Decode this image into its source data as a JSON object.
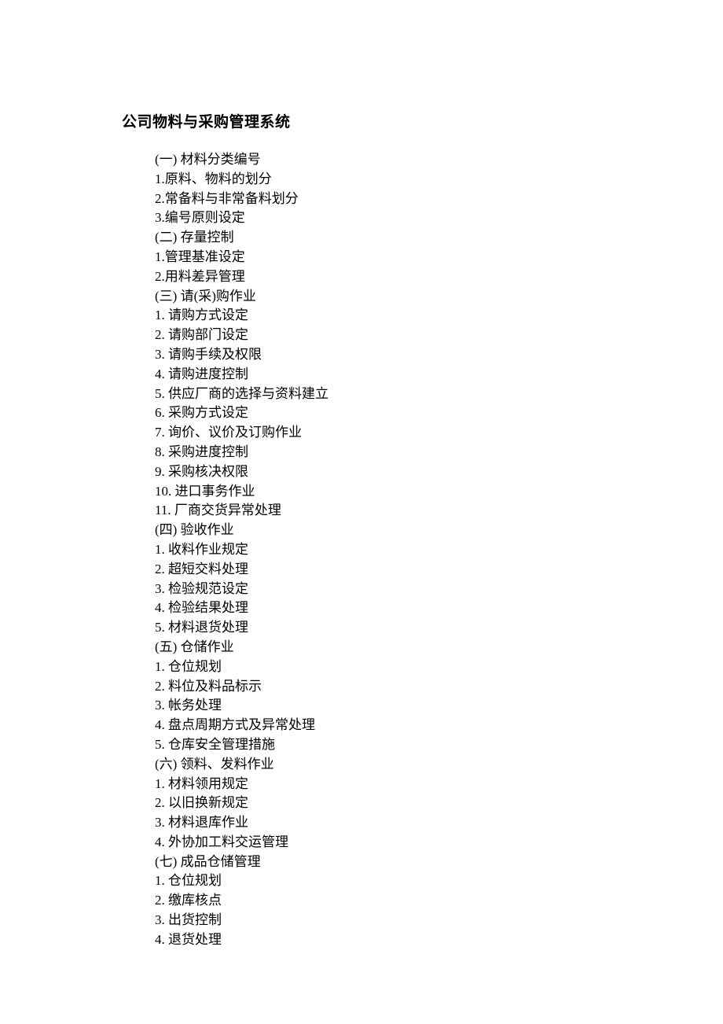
{
  "title": "公司物料与采购管理系统",
  "lines": [
    "(一) 材料分类编号",
    "1.原料、物料的划分",
    "2.常备料与非常备料划分",
    "3.编号原则设定",
    "(二) 存量控制",
    "1.管理基准设定",
    "2.用料差异管理",
    "(三) 请(采)购作业",
    "1. 请购方式设定",
    "2. 请购部门设定",
    "3. 请购手续及权限",
    "4. 请购进度控制",
    "5. 供应厂商的选择与资料建立",
    "6. 采购方式设定",
    "7. 询价、议价及订购作业",
    "8. 采购进度控制",
    "9. 采购核决权限",
    "10. 进口事务作业",
    "11. 厂商交货异常处理",
    "(四) 验收作业",
    "1. 收料作业规定",
    "2. 超短交料处理",
    "3. 检验规范设定",
    "4. 检验结果处理",
    "5. 材料退货处理",
    "(五) 仓储作业",
    "1. 仓位规划",
    "2. 料位及料品标示",
    "3. 帐务处理",
    "4. 盘点周期方式及异常处理",
    "5. 仓库安全管理措施",
    "(六) 领料、发料作业",
    "1. 材料领用规定",
    "2. 以旧换新规定",
    "3. 材料退库作业",
    "4. 外协加工料交运管理",
    "(七) 成品仓储管理",
    "1. 仓位规划",
    "2. 缴库核点",
    "3. 出货控制",
    "4. 退货处理"
  ]
}
